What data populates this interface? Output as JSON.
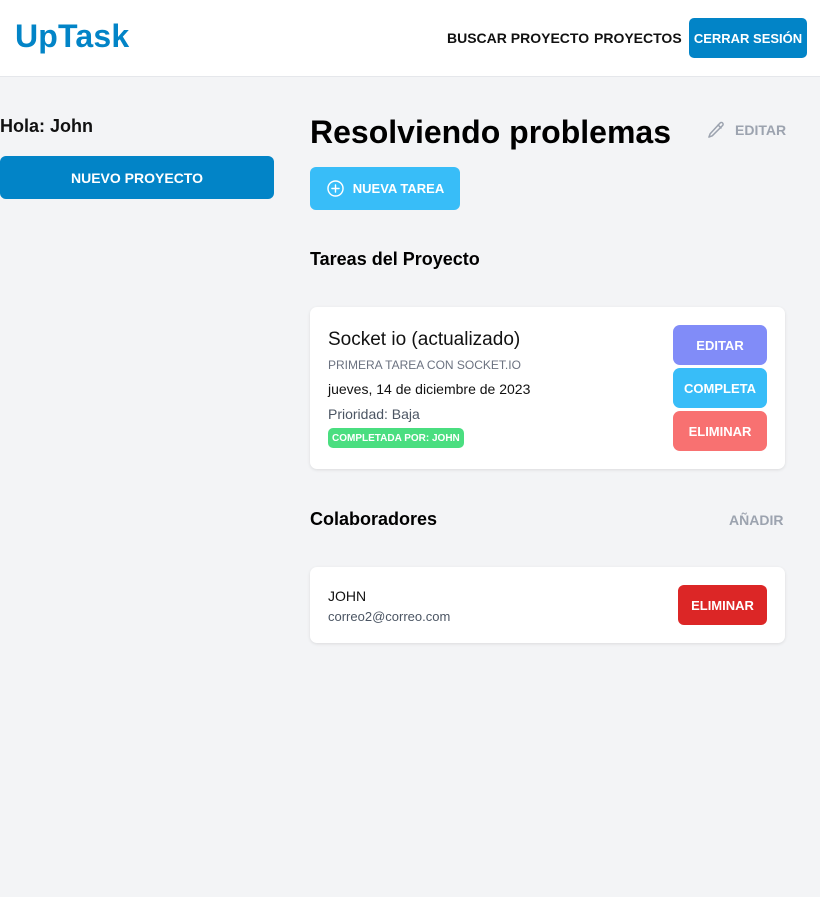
{
  "header": {
    "logo": "UpTask",
    "nav": {
      "search": "BUSCAR PROYECTO",
      "projects": "PROYECTOS"
    },
    "logout": "CERRAR SESIÓN"
  },
  "sidebar": {
    "greeting": "Hola: John",
    "new_project": "NUEVO PROYECTO"
  },
  "project": {
    "title": "Resolviendo problemas",
    "edit_label": "EDITAR",
    "new_task": "NUEVA TAREA"
  },
  "tasks": {
    "title": "Tareas del Proyecto",
    "items": [
      {
        "name": "Socket io (actualizado)",
        "description": "PRIMERA TAREA CON SOCKET.IO",
        "date": "jueves, 14 de diciembre de 2023",
        "priority": "Prioridad: Baja",
        "completed_by": "COMPLETADA POR: JOHN",
        "buttons": {
          "edit": "EDITAR",
          "complete": "COMPLETA",
          "delete": "ELIMINAR"
        }
      }
    ]
  },
  "collaborators": {
    "title": "Colaboradores",
    "add_label": "AÑADIR",
    "items": [
      {
        "name": "JOHN",
        "email": "correo2@correo.com",
        "delete": "ELIMINAR"
      }
    ]
  },
  "icons": {
    "edit": "pencil-icon",
    "new_task": "plus-circle-icon"
  },
  "colors": {
    "primary": "#0284c7",
    "sky": "#38bdf8",
    "indigo": "#818cf8",
    "red_light": "#f87171",
    "red": "#dc2626",
    "green": "#4ade80",
    "background": "#f3f4f6"
  }
}
